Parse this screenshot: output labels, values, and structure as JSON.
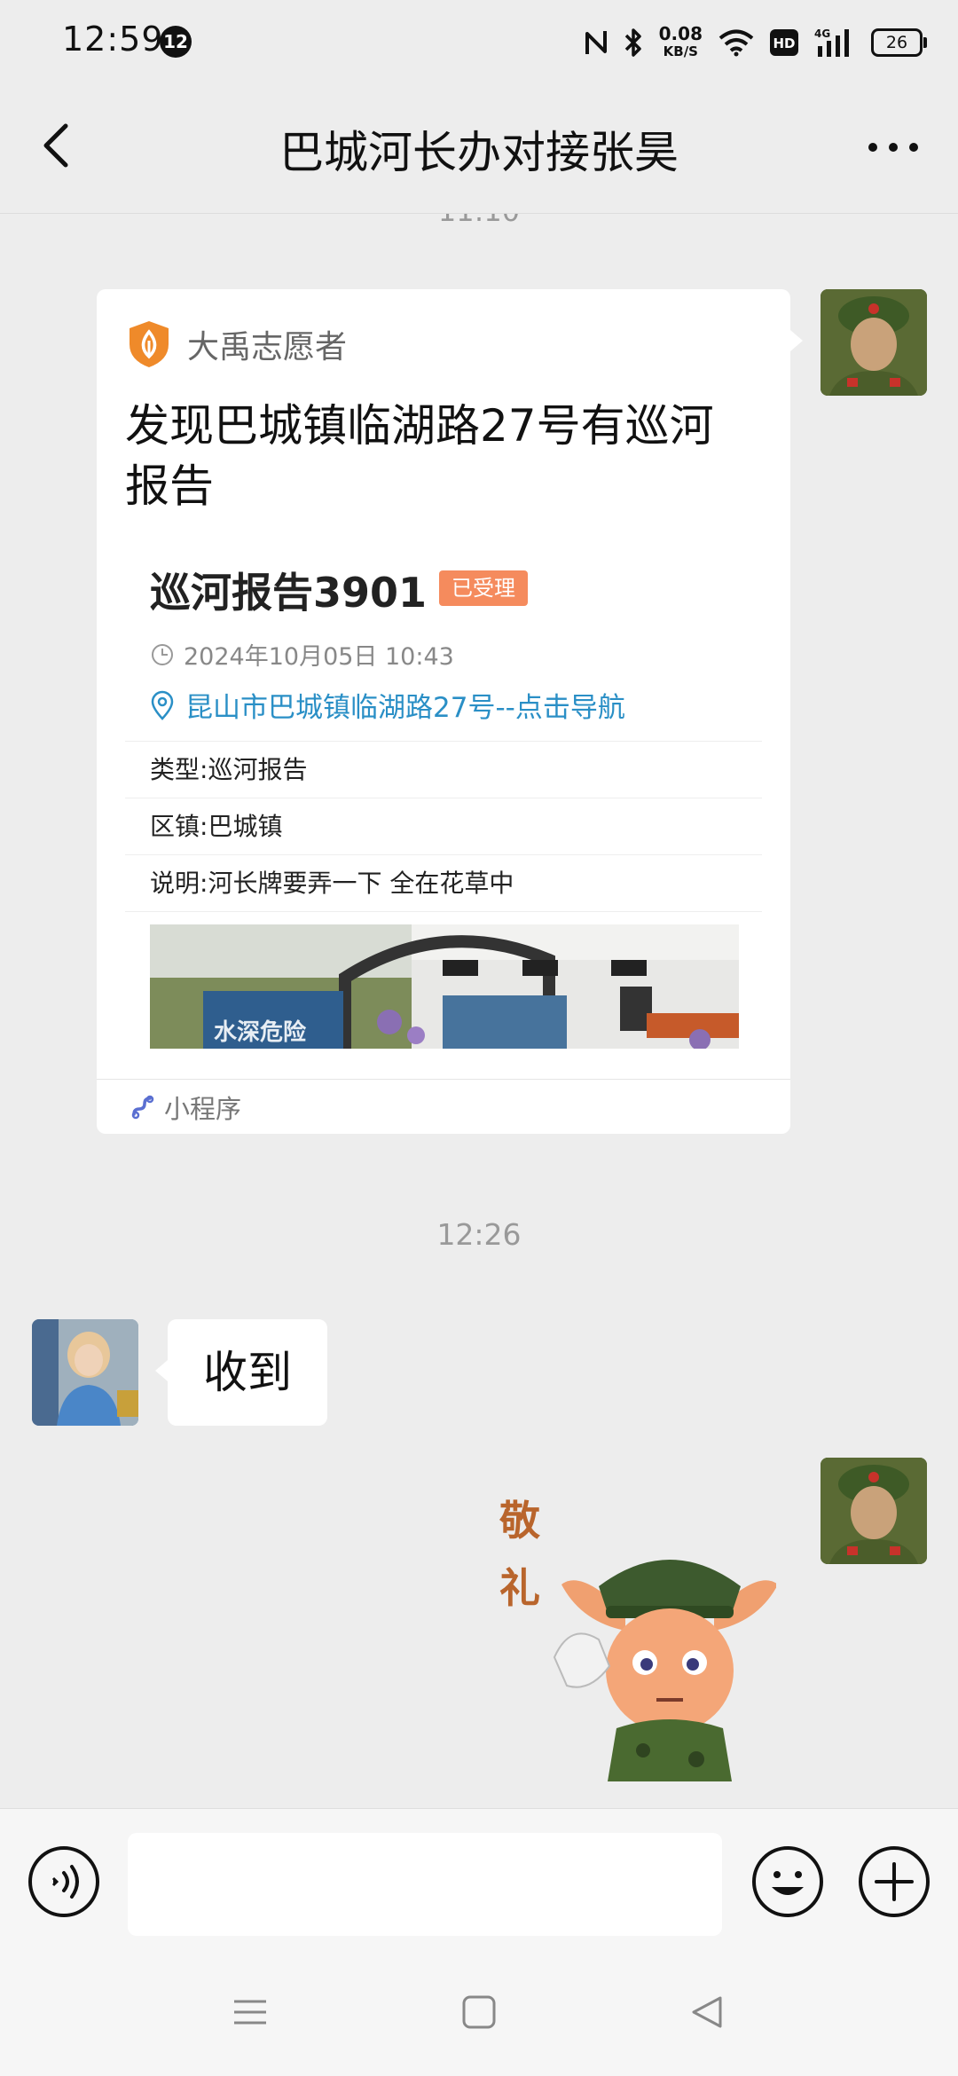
{
  "status_bar": {
    "time": "12:59",
    "notification_count": "12",
    "net_speed_value": "0.08",
    "net_speed_unit": "KB/S",
    "hd_label": "HD",
    "network_label": "4G",
    "battery_level": "26"
  },
  "header": {
    "title": "巴城河长办对接张昊",
    "back_icon": "chevron-left-icon",
    "more_icon": "more-dots-icon"
  },
  "chat": {
    "cut_timestamp": "11:10",
    "mini_program_card": {
      "source_name": "大禹志愿者",
      "title": "发现巴城镇临湖路27号有巡河报告",
      "report_name": "巡河报告3901",
      "status_tag": "已受理",
      "date": "2024年10月05日 10:43",
      "address": "昆山市巴城镇临湖路27号--点击导航",
      "fields": [
        {
          "label": "类型:",
          "value": "巡河报告"
        },
        {
          "label": "区镇:",
          "value": "巴城镇"
        },
        {
          "label": "说明:",
          "value": "河长牌要弄一下 全在花草中"
        }
      ],
      "photo_sign_text": "水深危险",
      "footer_label": "小程序",
      "accent_color": "#2a8fc6",
      "tag_color": "#f58b5d",
      "brand_color": "#ef8a2a"
    },
    "timestamp": "12:26",
    "received_message": "收到",
    "sticker": {
      "line1": "敬",
      "line2": "礼"
    }
  },
  "input_bar": {
    "voice_icon": "voice-icon",
    "input_value": "",
    "emoji_icon": "emoji-icon",
    "plus_icon": "plus-icon"
  },
  "nav_bar": {
    "menu_icon": "menu-icon",
    "home_icon": "home-square-icon",
    "back_icon": "back-triangle-icon"
  }
}
